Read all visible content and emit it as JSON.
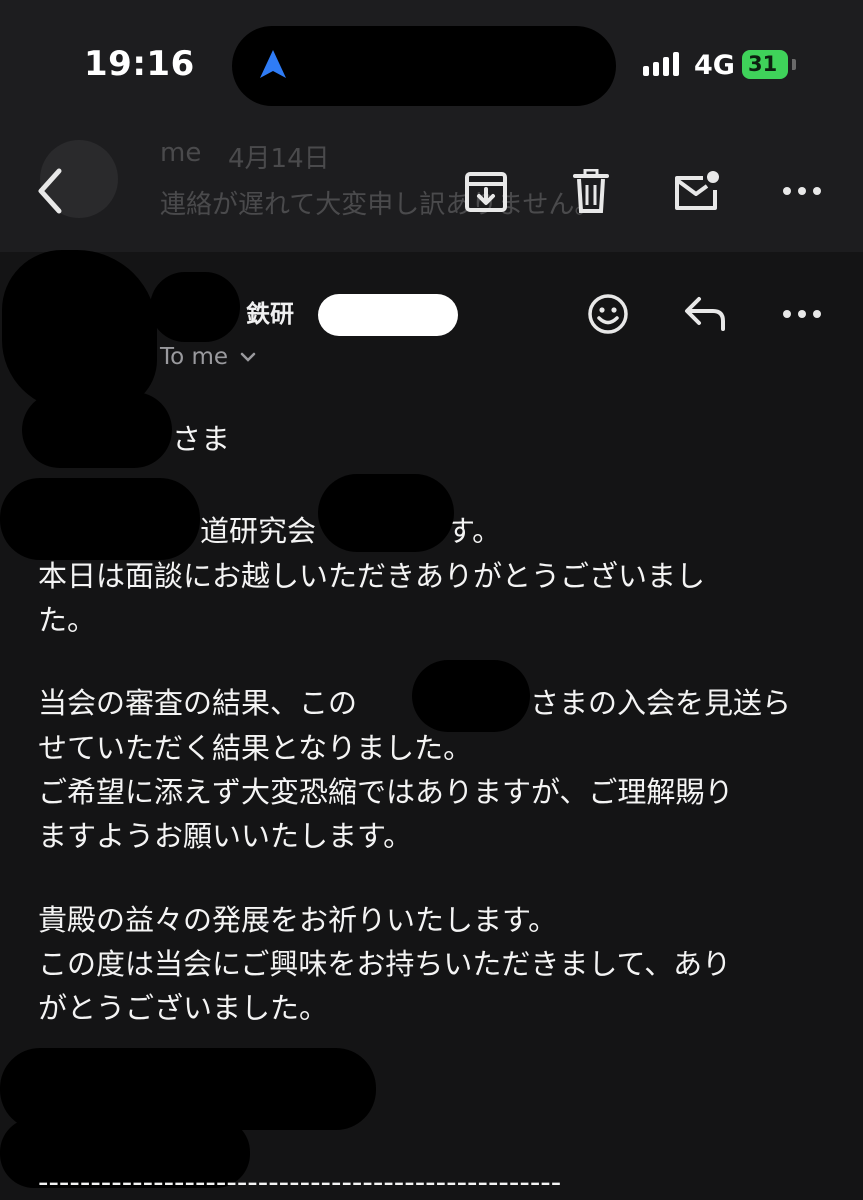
{
  "status_bar": {
    "time": "19:16",
    "network": "4G",
    "battery": "31"
  },
  "toolbar": {
    "ghost_from": "me",
    "ghost_date": "4月14日",
    "ghost_preview": "連絡が遅れて大変申し訳ありません。"
  },
  "email": {
    "sender": "鉄研",
    "recipient": "To me",
    "body": {
      "greeting": "さま",
      "intro": "道研究会",
      "intro_end": "す。",
      "line1": "本日は面談にお越しいただきありがとうございまし",
      "line2": "た。",
      "line3a": "当会の審査の結果、この",
      "line3b": "さまの入会を見送ら",
      "line4": "せていただく結果となりました。",
      "line5": "ご希望に添えず大変恐縮ではありますが、ご理解賜り",
      "line6": "ますようお願いいたします。",
      "line7": "貴殿の益々の発展をお祈りいたします。",
      "line8": "この度は当会にご興味をお持ちいただきまして、あり",
      "line9": "がとうございました。",
      "divider": "--------------------------------------------------"
    }
  },
  "colors": {
    "background": "#141415",
    "bar": "#1d1d1f",
    "battery": "#3fd25a",
    "accent": "#3b82f6"
  }
}
